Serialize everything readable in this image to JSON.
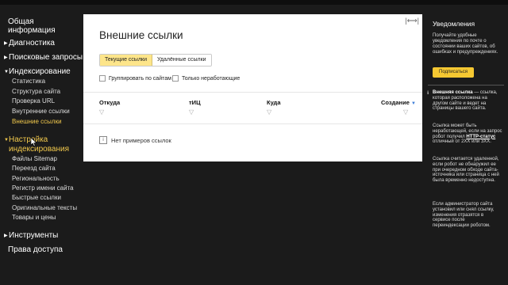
{
  "sidebar": {
    "general_info_line1": "Общая",
    "general_info_line2": "информация",
    "sections": [
      {
        "label": "Диагностика"
      },
      {
        "label": "Поисковые запросы"
      },
      {
        "label": "Индексирование"
      },
      {
        "label": "Настройка индексирования"
      },
      {
        "label": "Инструменты"
      },
      {
        "label": "Права доступа"
      }
    ],
    "indexing_items": [
      "Статистика",
      "Структура сайта",
      "Проверка URL",
      "Внутренние ссылки",
      "Внешние ссылки"
    ],
    "settings_label_line1": "Настройка",
    "settings_label_line2": "индексирования",
    "settings_items": [
      "Файлы Sitemap",
      "Переезд сайта",
      "Региональность",
      "Регистр имени сайта",
      "Быстрые ссылки",
      "Оригинальные тексты",
      "Товары и цены"
    ]
  },
  "main": {
    "title": "Внешние ссылки",
    "tabs": [
      "Текущие ссылки",
      "Удалённые ссылки"
    ],
    "checkboxes": [
      "Группировать по сайтам",
      "Только неработающие"
    ],
    "columns": [
      "Откуда",
      "тИЦ",
      "Куда",
      "Создание"
    ],
    "empty_message": "Нет примеров ссылок"
  },
  "notifications": {
    "title": "Уведомления",
    "text": "Получайте удобные уведомления по почте о состоянии ваших сайтов, об ошибках и предупреждениях.",
    "button": "Подписаться"
  },
  "help": {
    "term": "Внешняя ссылка",
    "p1_rest": " — ссылка, которая расположена на другом сайте и ведет на страницы вашего сайта.",
    "p2_start": "Ссылка может быть неработающей, если на запрос робот получил ",
    "p2_link": "HTTP-статус",
    "p2_end": " отличный от 2XX или 3XX.",
    "p3": "Ссылка считается удаленной, если робот не обнаружил ее при очередном обходе сайта-источника или страница с ней была временно недоступна.",
    "p4": "Если администратор сайта установил или снял ссылку, изменения отразятся в сервисе после переиндексации роботом."
  },
  "colors": {
    "accent": "#f2c94c",
    "tab_selected": "#fde58a",
    "button": "#f5c832",
    "background": "#1b1b1b"
  }
}
